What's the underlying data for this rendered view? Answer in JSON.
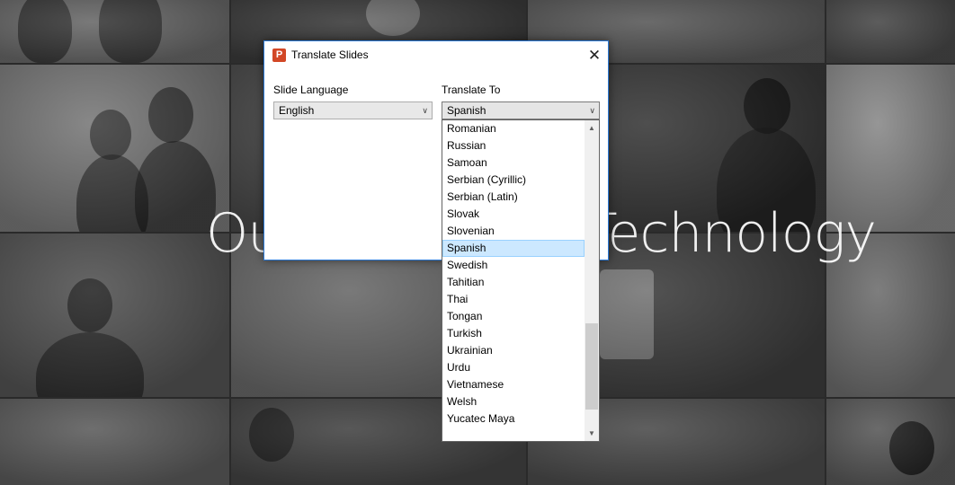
{
  "background": {
    "headline_left": "Ou",
    "headline_right": "Technology"
  },
  "dialog": {
    "title": "Translate Slides",
    "close_glyph": "✕",
    "slide_language": {
      "label": "Slide Language",
      "value": "English"
    },
    "translate_to": {
      "label": "Translate To",
      "value": "Spanish"
    }
  },
  "dropdown": {
    "options": [
      "Romanian",
      "Russian",
      "Samoan",
      "Serbian (Cyrillic)",
      "Serbian (Latin)",
      "Slovak",
      "Slovenian",
      "Spanish",
      "Swedish",
      "Tahitian",
      "Thai",
      "Tongan",
      "Turkish",
      "Ukrainian",
      "Urdu",
      "Vietnamese",
      "Welsh",
      "Yucatec Maya"
    ],
    "selected": "Spanish",
    "scroll_position": 0.92
  },
  "icons": {
    "app": "powerpoint-icon",
    "close": "close-icon",
    "chevron": "chevron-down-icon"
  },
  "colors": {
    "accent_border": "#2b79d6",
    "selection": "#cce8ff",
    "app_icon": "#d24726"
  }
}
